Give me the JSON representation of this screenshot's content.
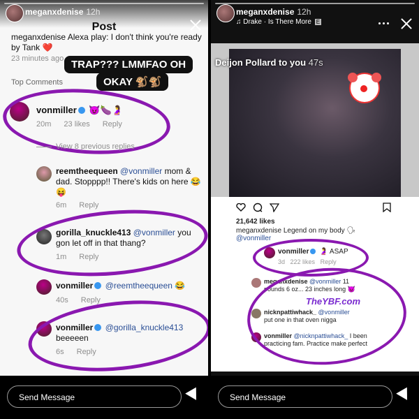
{
  "left": {
    "story_user": "meganxdenise",
    "story_time": "12h",
    "header_title": "Post",
    "caption": "meganxdenise Alexa play: I don't think you're ready by Tank ❤️",
    "caption_time": "23 minutes ago",
    "overlay_text_line1": "TRAP??? LMMFAO OH",
    "overlay_text_line2": "OKAY 🐒🐒",
    "top_comments_label": "Top Comments",
    "comment1_user": "vonmiller",
    "comment1_emoji": "😈🍆🤰",
    "comment1_time": "20m",
    "comment1_likes": "23 likes",
    "comment1_reply": "Reply",
    "view_replies": "View 8 previous replies",
    "comment2_user": "reemtheequeen",
    "comment2_mention": "@vonmiller",
    "comment2_text": "mom & dad. Stopppp!! There's kids on here 😂😝",
    "comment2_time": "6m",
    "comment2_reply": "Reply",
    "comment3_user": "gorilla_knuckle413",
    "comment3_mention": "@vonmiller",
    "comment3_text": "you gon let off in that thang?",
    "comment3_time": "1m",
    "comment3_reply": "Reply",
    "comment4_user": "vonmiller",
    "comment4_mention": "@reemtheequeen",
    "comment4_emoji": "😂",
    "comment4_time": "40s",
    "comment4_reply": "Reply",
    "comment5_user": "vonmiller",
    "comment5_mention": "@gorilla_knuckle413",
    "comment5_text": "beeeeen",
    "comment5_time": "6s",
    "comment5_reply": "Reply",
    "send_message": "Send Message",
    "circle_color": "#8a18b0"
  },
  "right": {
    "story_user": "meganxdenise",
    "story_time": "12h",
    "music": "Drake · Is There More",
    "explicit": "E",
    "tag_text": "Deijon Pollard to you",
    "tag_time": "47s",
    "likes": "21,642 likes",
    "caption": "meganxdenise Legend on my body 🗣",
    "caption_mention": "@vonmiller",
    "c1_user": "vonmiller",
    "c1_text": "🤰 ASAP",
    "c1_meta1": "3d",
    "c1_meta2": "222 likes",
    "c1_meta3": "Reply",
    "c2_user": "meganxdenise",
    "c2_mention": "@vonmiller",
    "c2_text": "11 pounds 6 oz... 23 inches long 😈",
    "watermark": "TheYBF.com",
    "c3_user": "nicknpattiwhack_",
    "c3_mention": "@vonmiller",
    "c3_text": "put one in that oven nigga",
    "c4_user": "vonmiller",
    "c4_mention": "@nicknpattiwhack_",
    "c4_text": "I been practicing fam. Practice make perfect",
    "send_message": "Send Message"
  }
}
